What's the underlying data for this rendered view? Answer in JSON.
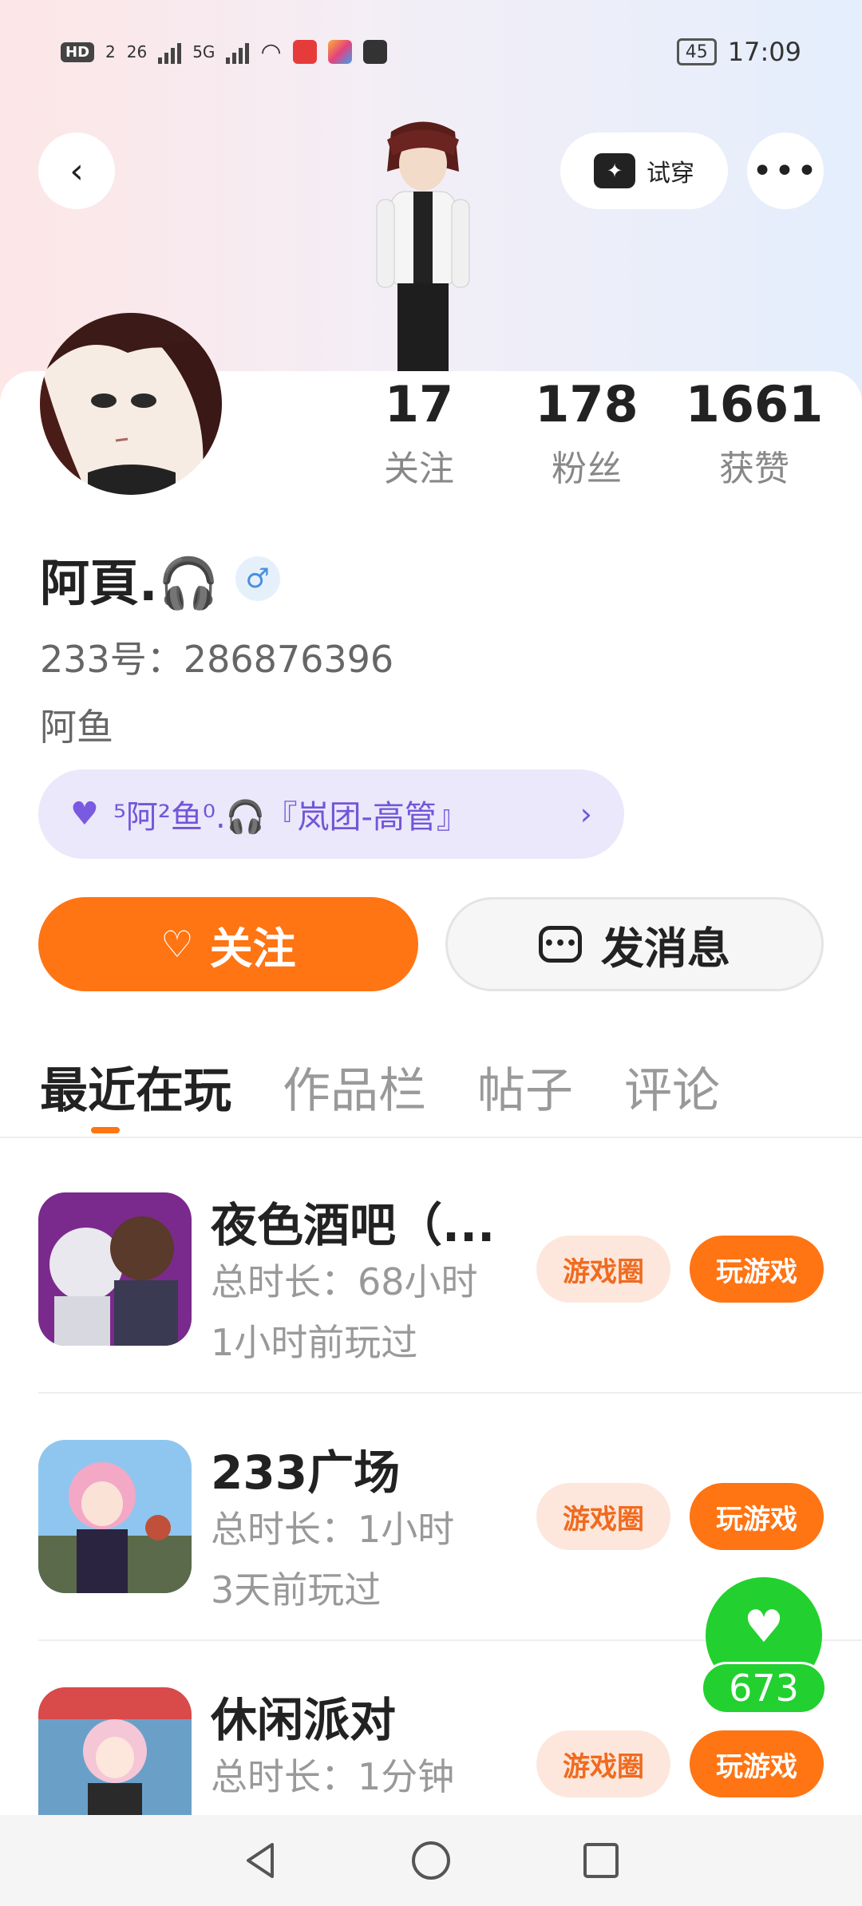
{
  "status_bar": {
    "time": "17:09",
    "battery": "45",
    "network_1": "HD",
    "network_2": "2",
    "network_3": "26",
    "network_4": "5G"
  },
  "header": {
    "tryon_label": "试穿"
  },
  "profile": {
    "name": "阿頁.🎧",
    "gender_icon": "male-icon",
    "uid_label": "233号：286876396",
    "bio": "阿鱼",
    "stats": [
      {
        "value": "17",
        "label": "关注"
      },
      {
        "value": "178",
        "label": "粉丝"
      },
      {
        "value": "1661",
        "label": "获赞"
      }
    ],
    "group_badge": "⁵阿²鱼⁰.🎧『岚团-高管』"
  },
  "actions": {
    "follow_label": "关注",
    "message_label": "发消息"
  },
  "tabs": [
    "最近在玩",
    "作品栏",
    "帖子",
    "评论"
  ],
  "games": [
    {
      "title": "夜色酒吧（...",
      "duration": "总时长：68小时",
      "last_played": "1小时前玩过",
      "circle_btn": "游戏圈",
      "play_btn": "玩游戏"
    },
    {
      "title": "233广场",
      "duration": "总时长：1小时",
      "last_played": "3天前玩过",
      "circle_btn": "游戏圈",
      "play_btn": "玩游戏"
    },
    {
      "title": "休闲派对",
      "duration": "总时长：1分钟",
      "last_played": "",
      "circle_btn": "游戏圈",
      "play_btn": "玩游戏"
    }
  ],
  "like_fab": {
    "count": "673"
  },
  "colors": {
    "accent": "#ff7413",
    "like": "#22d12f",
    "badge": "#ebe8fb"
  }
}
